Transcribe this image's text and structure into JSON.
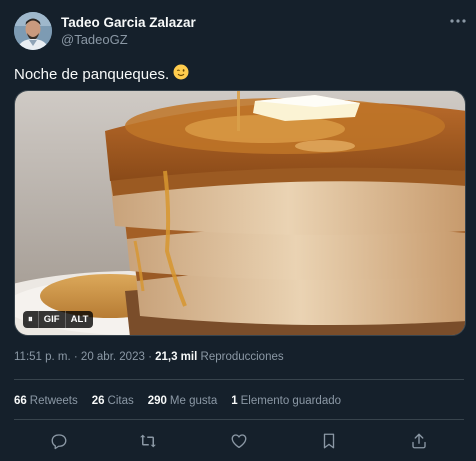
{
  "author": {
    "name": "Tadeo Garcia Zalazar",
    "handle": "@TadeoGZ"
  },
  "tweet": {
    "text": "Noche de panqueques.",
    "emoji": "😉",
    "media": {
      "type": "gif",
      "image_description": "stack-of-pancakes-with-syrup-and-butter",
      "badges": [
        "⏸",
        "GIF",
        "ALT"
      ]
    }
  },
  "meta": {
    "time": "11:51 p. m.",
    "separator": " · ",
    "date": "20 abr. 2023",
    "views_count": "21,3 mil",
    "views_label": "Reproducciones"
  },
  "stats": [
    {
      "count": "66",
      "label": "Retweets"
    },
    {
      "count": "26",
      "label": "Citas"
    },
    {
      "count": "290",
      "label": "Me gusta"
    },
    {
      "count": "1",
      "label": "Elemento guardado"
    }
  ],
  "actions": [
    "reply-icon",
    "retweet-icon",
    "like-icon",
    "bookmark-icon",
    "share-icon"
  ],
  "colors": {
    "background": "#15202b",
    "text": "#f7f9f9",
    "secondary": "#8b98a5",
    "border": "#38444d"
  }
}
